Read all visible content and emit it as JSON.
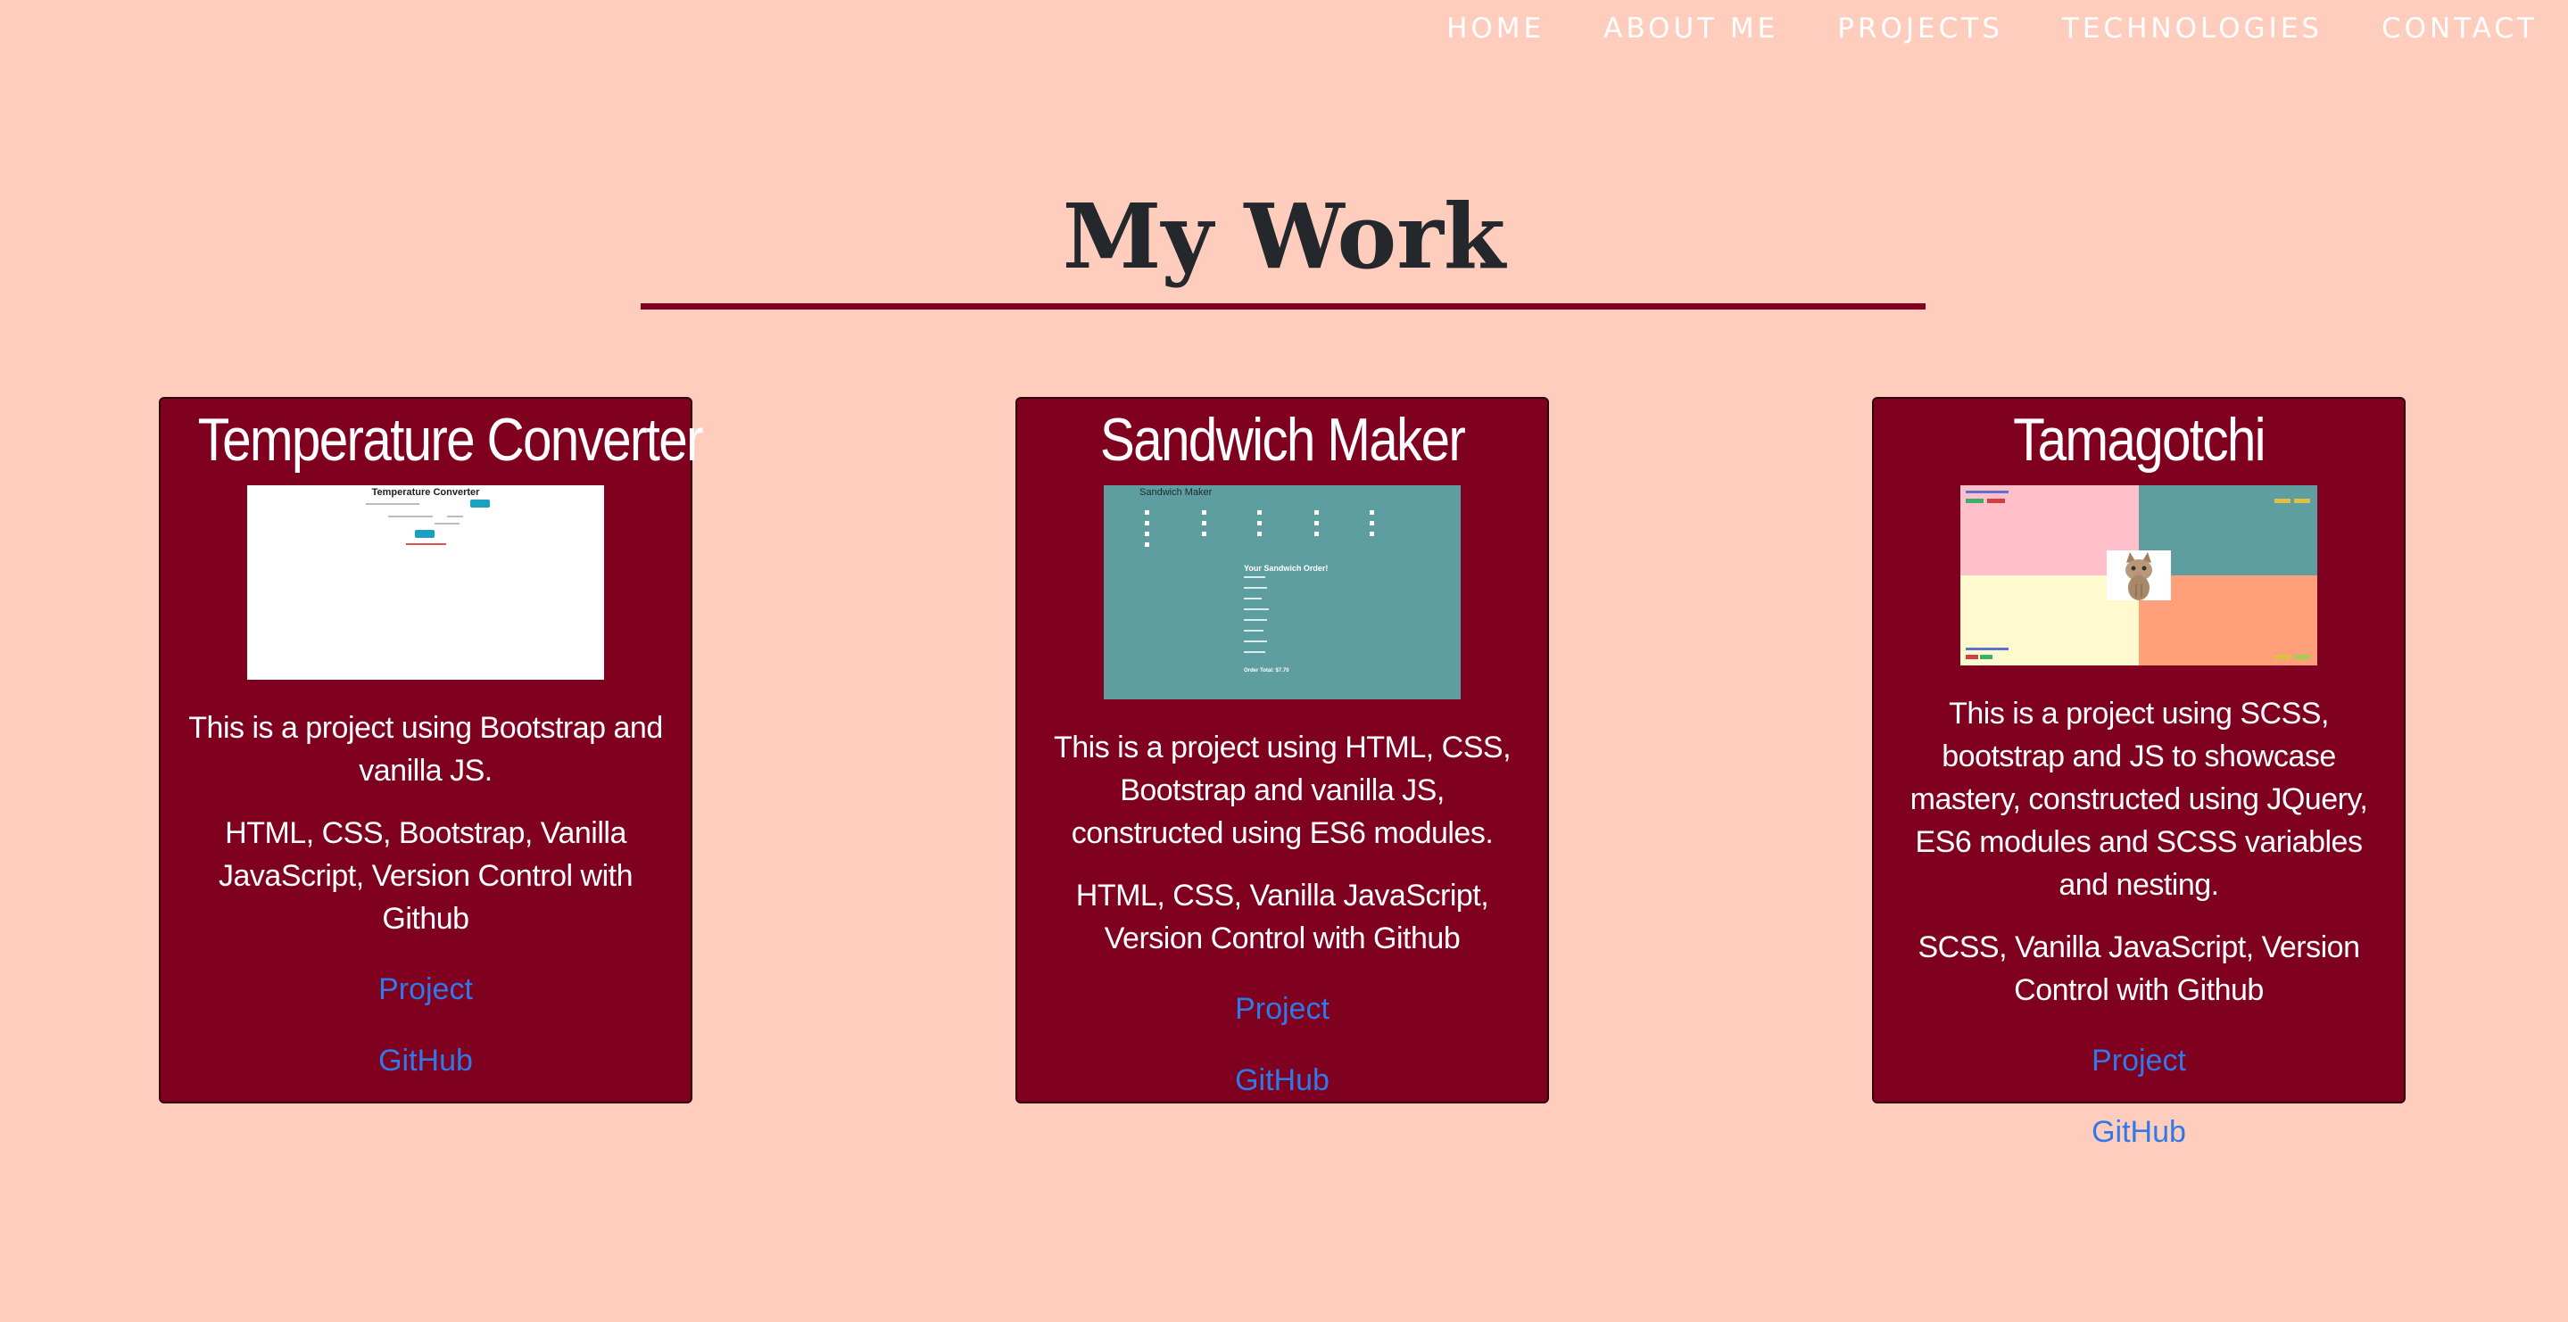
{
  "nav": {
    "home": "HOME",
    "about": "ABOUT ME",
    "projects": "PROJECTS",
    "technologies": "TECHNOLOGIES",
    "contact": "CONTACT"
  },
  "section": {
    "title": "My Work"
  },
  "projects": [
    {
      "title": "Temperature Converter",
      "screenshot_title": "Temperature Converter",
      "description": "This is a project using Bootstrap and vanilla JS.",
      "tech": "HTML, CSS, Bootstrap, Vanilla JavaScript, Version Control with Github",
      "project_link": "Project",
      "github_link": "GitHub"
    },
    {
      "title": "Sandwich Maker",
      "screenshot_title": "Sandwich Maker",
      "screenshot_order": "Your Sandwich Order!",
      "screenshot_total": "Order Total: $7.70",
      "description": "This is a project using HTML, CSS, Bootstrap and vanilla JS, constructed using ES6 modules.",
      "tech": "HTML, CSS, Vanilla JavaScript, Version Control with Github",
      "project_link": "Project",
      "github_link": "GitHub"
    },
    {
      "title": "Tamagotchi",
      "description": "This is a project using SCSS, bootstrap and JS to showcase mastery, constructed using JQuery, ES6 modules and SCSS variables and nesting.",
      "tech": "SCSS, Vanilla JavaScript, Version Control with Github",
      "project_link": "Project",
      "github_link": "GitHub"
    }
  ],
  "colors": {
    "background": "#ffcdbd",
    "card": "#800020",
    "link": "#3079e8",
    "heading": "#24272b"
  }
}
